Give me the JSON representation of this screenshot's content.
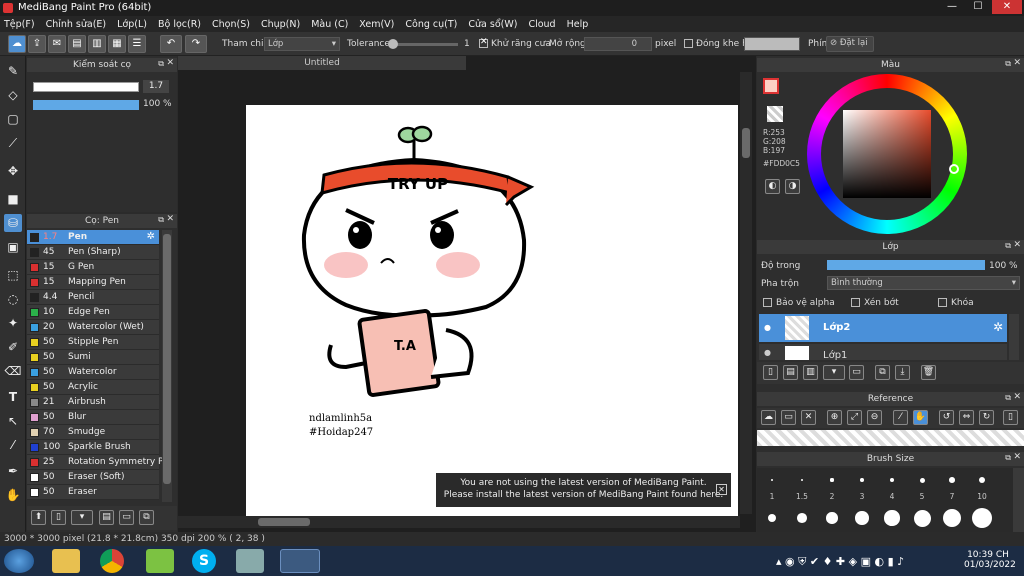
{
  "window": {
    "title": "MediBang Paint Pro (64bit)",
    "minimize": "—",
    "maximize": "☐",
    "close": "✕"
  },
  "menu": [
    "Tệp(F)",
    "Chỉnh sửa(E)",
    "Lớp(L)",
    "Bộ lọc(R)",
    "Chọn(S)",
    "Chụp(N)",
    "Màu (C)",
    "Xem(V)",
    "Công cụ(T)",
    "Cửa sổ(W)",
    "Cloud",
    "Help"
  ],
  "toolbar": {
    "reference_label": "Tham chiếu",
    "reference_value": "Lớp",
    "tolerance_label": "Tolerance",
    "tolerance_value": "1",
    "antialias_label": "Khử răng cưa",
    "expand_label": "Mở rộng",
    "expand_value": "0",
    "expand_unit": "pixel",
    "close_gap_label": "Đóng khe hở",
    "shortcut_label": "Phím",
    "reset_label": "Đặt lại"
  },
  "brush_control": {
    "title": "Kiểm soát cọ",
    "size_value": "1.7",
    "opacity_value": "100 %",
    "size_level": 0.98,
    "opacity_level": 1.0
  },
  "brush_panel": {
    "title": "Cọ: Pen",
    "items": [
      {
        "size": "1.7",
        "name": "Pen",
        "color": "#222222",
        "selected": true
      },
      {
        "size": "45",
        "name": "Pen (Sharp)",
        "color": "#222222"
      },
      {
        "size": "15",
        "name": "G Pen",
        "color": "#d93030"
      },
      {
        "size": "15",
        "name": "Mapping Pen",
        "color": "#d93030"
      },
      {
        "size": "4.4",
        "name": "Pencil",
        "color": "#222222"
      },
      {
        "size": "10",
        "name": "Edge Pen",
        "color": "#2bb14a"
      },
      {
        "size": "20",
        "name": "Watercolor (Wet)",
        "color": "#3aa0e0"
      },
      {
        "size": "50",
        "name": "Stipple Pen",
        "color": "#e8d020"
      },
      {
        "size": "50",
        "name": "Sumi",
        "color": "#e8d020"
      },
      {
        "size": "50",
        "name": "Watercolor",
        "color": "#3aa0e0"
      },
      {
        "size": "50",
        "name": "Acrylic",
        "color": "#e8d020"
      },
      {
        "size": "21",
        "name": "Airbrush",
        "color": "#888888"
      },
      {
        "size": "50",
        "name": "Blur",
        "color": "#e0a0d0"
      },
      {
        "size": "70",
        "name": "Smudge",
        "color": "#e0d0b0"
      },
      {
        "size": "100",
        "name": "Sparkle Brush",
        "color": "#2040d0"
      },
      {
        "size": "25",
        "name": "Rotation Symmetry Pe",
        "color": "#d93030"
      },
      {
        "size": "50",
        "name": "Eraser (Soft)",
        "color": "#ffffff"
      },
      {
        "size": "50",
        "name": "Eraser",
        "color": "#ffffff"
      }
    ]
  },
  "canvas": {
    "tab_title": "Untitled",
    "drawing_text": "TRY UP",
    "book_text": "T.A",
    "watermark_line1": "ndlamlinh5a",
    "watermark_line2": "#Hoidap247",
    "notice_line1": "You are not using the latest version of MediBang Paint.",
    "notice_line2": "Please install the latest version of MediBang Paint found here."
  },
  "color_panel": {
    "title": "Màu",
    "r": "R:253",
    "g": "G:208",
    "b": "B:197",
    "hex": "#FDD0C5",
    "current_color": "#fdd0c5"
  },
  "layer_panel": {
    "title": "Lớp",
    "opacity_label": "Độ trong",
    "opacity_value": "100 %",
    "blend_label": "Pha trộn",
    "blend_value": "Bình thường",
    "protect_alpha": "Bảo vệ alpha",
    "clipping": "Xén bớt",
    "lock": "Khóa",
    "layers": [
      "Lớp2",
      "Lớp1"
    ]
  },
  "reference_panel": {
    "title": "Reference"
  },
  "brush_size_panel": {
    "title": "Brush Size",
    "sizes": [
      "1",
      "1.5",
      "2",
      "3",
      "4",
      "5",
      "7",
      "10"
    ]
  },
  "status": {
    "text": "3000 * 3000 pixel   (21.8 * 21.8cm)   350 dpi   200 %   ( 2, 38 )"
  },
  "taskbar": {
    "time": "10:39 CH",
    "date": "01/03/2022"
  },
  "icons": [
    "start-orb-icon",
    "folder-icon",
    "chrome-icon",
    "skype-icon",
    "paint-icon"
  ]
}
